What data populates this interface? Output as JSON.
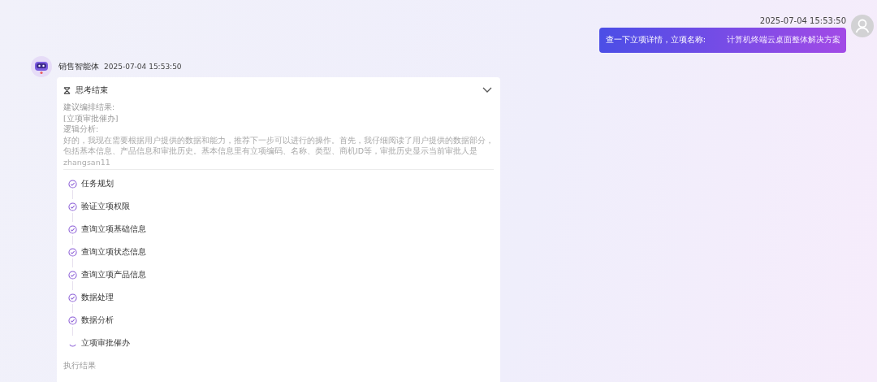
{
  "user_message": {
    "time": "2025-07-04 15:53:50",
    "text": "查一下立项详情，立项名称:",
    "highlight": "计算机终端云桌面整体解决方案"
  },
  "bot_message": {
    "name": "销售智能体",
    "time": "2025-07-04 15:53:50",
    "thinking": {
      "title": "思考结束",
      "expanded": true,
      "lines": [
        "建议编排结果:",
        "[立项审批催办]",
        "逻辑分析:",
        "好的，我现在需要根据用户提供的数据和能力，推荐下一步可以进行的操作。首先，我仔细阅读了用户提供的数据部分，包括基本信息、产品信息和审批历史。基本信息里有立项编码、名称、类型、商机ID等，审批历史显示当前审批人是",
        "zhangsan11"
      ]
    },
    "steps": [
      {
        "label": "任务规划",
        "done": true
      },
      {
        "label": "验证立项权限",
        "done": true
      },
      {
        "label": "查询立项基础信息",
        "done": true
      },
      {
        "label": "查询立项状态信息",
        "done": true
      },
      {
        "label": "查询立项产品信息",
        "done": true
      },
      {
        "label": "数据处理",
        "done": true
      },
      {
        "label": "数据分析",
        "done": true
      },
      {
        "label": "立项审批催办",
        "done": false
      }
    ],
    "result_heading": "执行结果"
  }
}
